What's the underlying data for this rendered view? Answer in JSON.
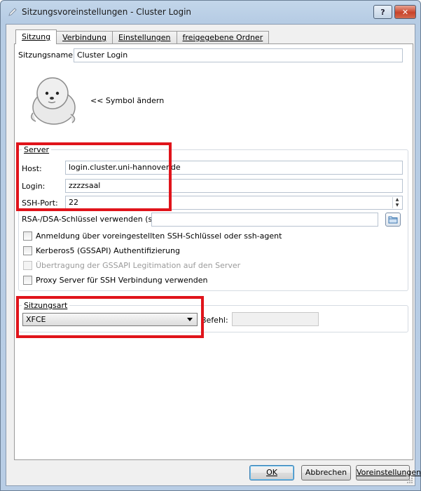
{
  "window": {
    "title": "Sitzungsvoreinstellungen - Cluster Login",
    "help_label": "?",
    "close_label": "✕"
  },
  "tabs": [
    {
      "label": "Sitzung",
      "active": true
    },
    {
      "label": "Verbindung",
      "active": false
    },
    {
      "label": "Einstellungen",
      "active": false
    },
    {
      "label": "freigegebene Ordner",
      "active": false
    }
  ],
  "session": {
    "name_label": "Sitzungsname:",
    "name_value": "Cluster Login",
    "icon_name": "seal-icon",
    "change_symbol_label": "<< Symbol ändern"
  },
  "server": {
    "group_title": "Server",
    "host_label": "Host:",
    "host_value": "login.cluster.uni-hannover.de",
    "login_label": "Login:",
    "login_value": "zzzzsaal",
    "port_label": "SSH-Port:",
    "port_value": "22",
    "key_label": "RSA-/DSA-Schlüssel verwenden (ssh):",
    "key_value": "",
    "checkboxes": [
      {
        "label": "Anmeldung über voreingestellten SSH-Schlüssel oder ssh-agent",
        "checked": false,
        "enabled": true
      },
      {
        "label": "Kerberos5 (GSSAPI) Authentifizierung",
        "checked": false,
        "enabled": true
      },
      {
        "label": "Übertragung der GSSAPI Legitimation auf den Server",
        "checked": false,
        "enabled": false
      },
      {
        "label": "Proxy Server für SSH Verbindung verwenden",
        "checked": false,
        "enabled": true
      }
    ]
  },
  "session_type": {
    "group_title": "Sitzungsart",
    "selected": "XFCE",
    "command_label": "Befehl:",
    "command_value": ""
  },
  "footer": {
    "ok_label": "OK",
    "cancel_label": "Abbrechen",
    "defaults_label": "Voreinstellungen"
  },
  "colors": {
    "highlight_box": "#e0141b"
  }
}
